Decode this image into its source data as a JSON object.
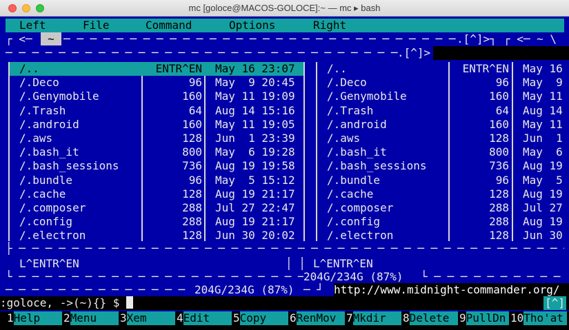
{
  "window": {
    "title": "mc [goloce@MACOS-GOLOCE]:~ — mc ▸ bash"
  },
  "menu": [
    "Left",
    "File",
    "Command",
    "Options",
    "Right"
  ],
  "left_panel": {
    "top_border_left": "┌ <─ ",
    "tilde": "~",
    "top_border_right": ".[^]>┐",
    "mini_status": "L^ENTR^EN",
    "free_space": "204G/234G (87%)",
    "columns": {
      "size": "ENTR^EN",
      "mtime": "May 16 23:07"
    },
    "rows": [
      {
        "name": "/..",
        "size": "ENTR^EN",
        "mtime": "May 16 23:07",
        "selected": true
      },
      {
        "name": "/.Deco",
        "size": "96",
        "mtime": "May  9 20:45"
      },
      {
        "name": "/.Genymobile",
        "size": "160",
        "mtime": "May 11 19:09"
      },
      {
        "name": "/.Trash",
        "size": "64",
        "mtime": "Aug 14 15:16"
      },
      {
        "name": "/.android",
        "size": "160",
        "mtime": "May 11 19:05"
      },
      {
        "name": "/.aws",
        "size": "128",
        "mtime": "Jun  1 23:39"
      },
      {
        "name": "/.bash_it",
        "size": "800",
        "mtime": "May  6 19:28"
      },
      {
        "name": "/.bash_sessions",
        "size": "736",
        "mtime": "Aug 19 19:58"
      },
      {
        "name": "/.bundle",
        "size": "96",
        "mtime": "May  5 15:12"
      },
      {
        "name": "/.cache",
        "size": "128",
        "mtime": "Aug 19 21:17"
      },
      {
        "name": "/.composer",
        "size": "288",
        "mtime": "Jul 27 22:47"
      },
      {
        "name": "/.config",
        "size": "288",
        "mtime": "Aug 19 21:17"
      },
      {
        "name": "/.electron",
        "size": "128",
        "mtime": "Jun 30 20:02"
      }
    ]
  },
  "right_panel": {
    "top_border": "┌ <─ ~ \\",
    "sub_border": ".[^]>",
    "mini_status": "L^ENTR^EN",
    "free_space": "204G/234G (87%)",
    "rows": [
      {
        "name": "/..",
        "size": "ENTR^EN",
        "mtime": "May 16"
      },
      {
        "name": "/.Deco",
        "size": "96",
        "mtime": "May  9"
      },
      {
        "name": "/.Genymobile",
        "size": "160",
        "mtime": "May 11"
      },
      {
        "name": "/.Trash",
        "size": "64",
        "mtime": "Aug 14"
      },
      {
        "name": "/.android",
        "size": "160",
        "mtime": "May 11"
      },
      {
        "name": "/.aws",
        "size": "128",
        "mtime": "Jun  1"
      },
      {
        "name": "/.bash_it",
        "size": "800",
        "mtime": "May  6"
      },
      {
        "name": "/.bash_sessions",
        "size": "736",
        "mtime": "Aug 19"
      },
      {
        "name": "/.bundle",
        "size": "96",
        "mtime": "May  5"
      },
      {
        "name": "/.cache",
        "size": "128",
        "mtime": "Aug 19"
      },
      {
        "name": "/.composer",
        "size": "288",
        "mtime": "Jul 27"
      },
      {
        "name": "/.config",
        "size": "288",
        "mtime": "Aug 19"
      },
      {
        "name": "/.electron",
        "size": "128",
        "mtime": "Jun 30"
      }
    ]
  },
  "url": "http://www.midnight-commander.org/",
  "prompt": ":goloce, ->(~){} $",
  "prompt_caret": "[^]",
  "fkeys": [
    {
      "num": "1",
      "label": "Help"
    },
    {
      "num": "2",
      "label": "Menu"
    },
    {
      "num": "3",
      "label": "Xem"
    },
    {
      "num": "4",
      "label": "Edit"
    },
    {
      "num": "5",
      "label": "Copy"
    },
    {
      "num": "6",
      "label": "RenMov"
    },
    {
      "num": "7",
      "label": "Mkdir"
    },
    {
      "num": "8",
      "label": "Delete"
    },
    {
      "num": "9",
      "label": "PullDn"
    },
    {
      "num": "10",
      "label": "Tho'at"
    }
  ],
  "colors": {
    "panel_bg": "#0000a8",
    "accent": "#14a0a0",
    "text": "#eaeaea"
  }
}
